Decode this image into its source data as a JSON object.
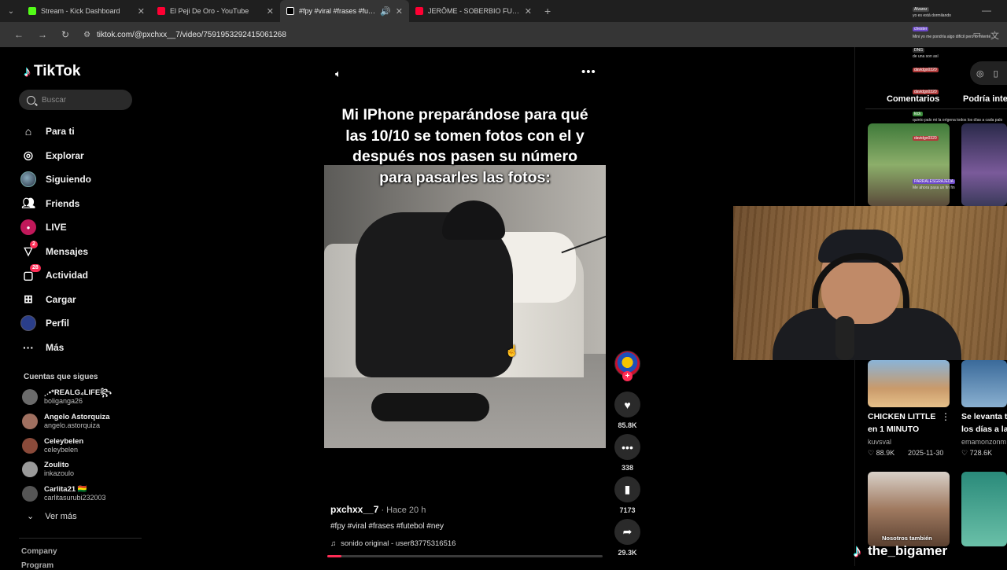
{
  "browser": {
    "tabs": [
      {
        "title": "Stream - Kick Dashboard",
        "favicon_color": "#53fc18",
        "active": false
      },
      {
        "title": "El Peji De Oro - YouTube",
        "favicon_color": "#ff0033",
        "active": false
      },
      {
        "title": "#fpy #viral #frases #futebol",
        "favicon_color": "#ffffff",
        "active": true
      },
      {
        "title": "JERÔME - SOBERBIO FUNK (Au",
        "favicon_color": "#ff0033",
        "active": false
      }
    ],
    "new_tab": "+",
    "url": "tiktok.com/@pxchxx__7/video/7591953292415061268"
  },
  "sidebar": {
    "brand": "TikTok",
    "search_placeholder": "Buscar",
    "nav": [
      {
        "label": "Para ti",
        "icon": "home-icon"
      },
      {
        "label": "Explorar",
        "icon": "compass-icon"
      },
      {
        "label": "Siguiendo",
        "icon": "following-avatar-icon"
      },
      {
        "label": "Friends",
        "icon": "friends-icon"
      },
      {
        "label": "LIVE",
        "icon": "live-icon"
      },
      {
        "label": "Mensajes",
        "icon": "messages-icon",
        "badge": "2"
      },
      {
        "label": "Actividad",
        "icon": "activity-icon",
        "badge": "28"
      },
      {
        "label": "Cargar",
        "icon": "upload-icon"
      },
      {
        "label": "Perfil",
        "icon": "profile-icon"
      },
      {
        "label": "Más",
        "icon": "more-icon"
      }
    ],
    "following_title": "Cuentas que sigues",
    "following": [
      {
        "name": "¸.•*REALG₄LIFE꧂",
        "handle": "boliganga26",
        "color": "#6b6b6b"
      },
      {
        "name": "Angelo Astorquiza",
        "handle": "angelo.astorquiza",
        "color": "#a07060"
      },
      {
        "name": "Celeybelen",
        "handle": "celeybelen",
        "color": "#8a4a3a"
      },
      {
        "name": "Zoulito",
        "handle": "inkazoulo",
        "color": "#9a9a9a"
      },
      {
        "name": "Carlita21 🇧🇴",
        "handle": "carlitasurubi232003",
        "color": "#555555"
      }
    ],
    "ver_mas": "Ver más",
    "company": "Company",
    "program": "Program"
  },
  "video": {
    "caption": "Mi IPhone preparándose para qué las 10/10 se tomen fotos con el y después nos pasen su número para pasarles las fotos:",
    "author": "pxchxx__7",
    "time": " · Hace 20 h",
    "tags": "#fpy #viral #frases #futebol #ney",
    "sound": "sonido original - user83775316516",
    "progress": 0.05
  },
  "actions": {
    "likes": "85.8K",
    "comments": "338",
    "saves": "7173",
    "shares": "29.3K"
  },
  "right_panel": {
    "tab_comments": "Comentarios",
    "tab_interest": "Podría inte",
    "videos": [
      {
        "title_1": "CHICKEN LITTLE",
        "title_2": "en 1 MINUTO",
        "author": "kuvsval",
        "likes": "♡ 88.9K",
        "date": "2025-11-30"
      },
      {
        "title_1": "Se levanta t",
        "title_2": "los días a la",
        "author": "emamonzonm",
        "likes": "♡ 728.6K",
        "date": ""
      }
    ],
    "thumb_overlay": "Nosotros también"
  },
  "chat": [
    {
      "name": "Alvarez",
      "color": "#444444",
      "text": "yo es está dormilando"
    },
    {
      "name": "chester",
      "color": "#6b48c8",
      "text": "Mini yo me pondría algo difícil pero lo intenté…"
    },
    {
      "name": "DNG",
      "color": "#333333",
      "text": "de una son así"
    },
    {
      "name": "davidgo0320",
      "color": "#b03a3a",
      "text": ""
    },
    {
      "name": "davidgo0320",
      "color": "#b03a3a",
      "text": ""
    },
    {
      "name": "kick",
      "color": "#3a8a3a",
      "text": "quinto palo mi la orígena todos los días a cada palo"
    },
    {
      "name": "davidgo0320",
      "color": "#b03a3a",
      "text": ""
    },
    {
      "name": "PARRALESGRAJEDA",
      "color": "#6b48c8",
      "text": "Me ahora pasa un fin fin"
    }
  ],
  "streamer": {
    "name": "the_bigamer"
  }
}
